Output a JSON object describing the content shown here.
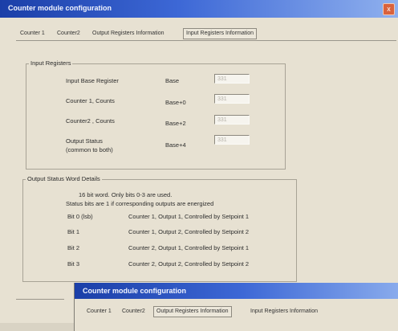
{
  "window": {
    "title": "Counter module configuration",
    "close_glyph": "x"
  },
  "tabs": [
    {
      "label": "Counter 1"
    },
    {
      "label": "Counter2"
    },
    {
      "label": "Output Registers Information"
    },
    {
      "label": "Input Registers Information"
    }
  ],
  "input_registers": {
    "group_label": "Input Registers",
    "rows": [
      {
        "label": "Input Base Register",
        "register": "Base",
        "value": "331"
      },
      {
        "label": "Counter 1, Counts",
        "register": "Base+0",
        "value": "331"
      },
      {
        "label": "Counter2 , Counts",
        "register": "Base+2",
        "value": "331"
      },
      {
        "label": "Output Status",
        "label2": "(common to both)",
        "register": "Base+4",
        "value": "331"
      }
    ]
  },
  "status_word": {
    "group_label": "Output Status Word Details",
    "note1": "16 bit word. Only bits 0-3 are used.",
    "note2": "Status bits are 1 if corresponding outputs are energized",
    "bits": [
      {
        "bit": "Bit 0 (lsb)",
        "desc": "Counter 1, Output 1, Controlled by Setpoint 1"
      },
      {
        "bit": "Bit 1",
        "desc": "Counter 1, Output 2, Controlled by Setpoint 2"
      },
      {
        "bit": "Bit 2",
        "desc": "Counter 2, Output 1, Controlled by Setpoint 1"
      },
      {
        "bit": "Bit 3",
        "desc": "Counter 2, Output 2, Controlled by Setpoint 2"
      }
    ]
  },
  "second_window": {
    "title": "Counter module configuration",
    "tabs": [
      {
        "label": "Counter 1"
      },
      {
        "label": "Counter2"
      },
      {
        "label": "Output Registers Information"
      },
      {
        "label": "Input Registers Information"
      }
    ]
  }
}
